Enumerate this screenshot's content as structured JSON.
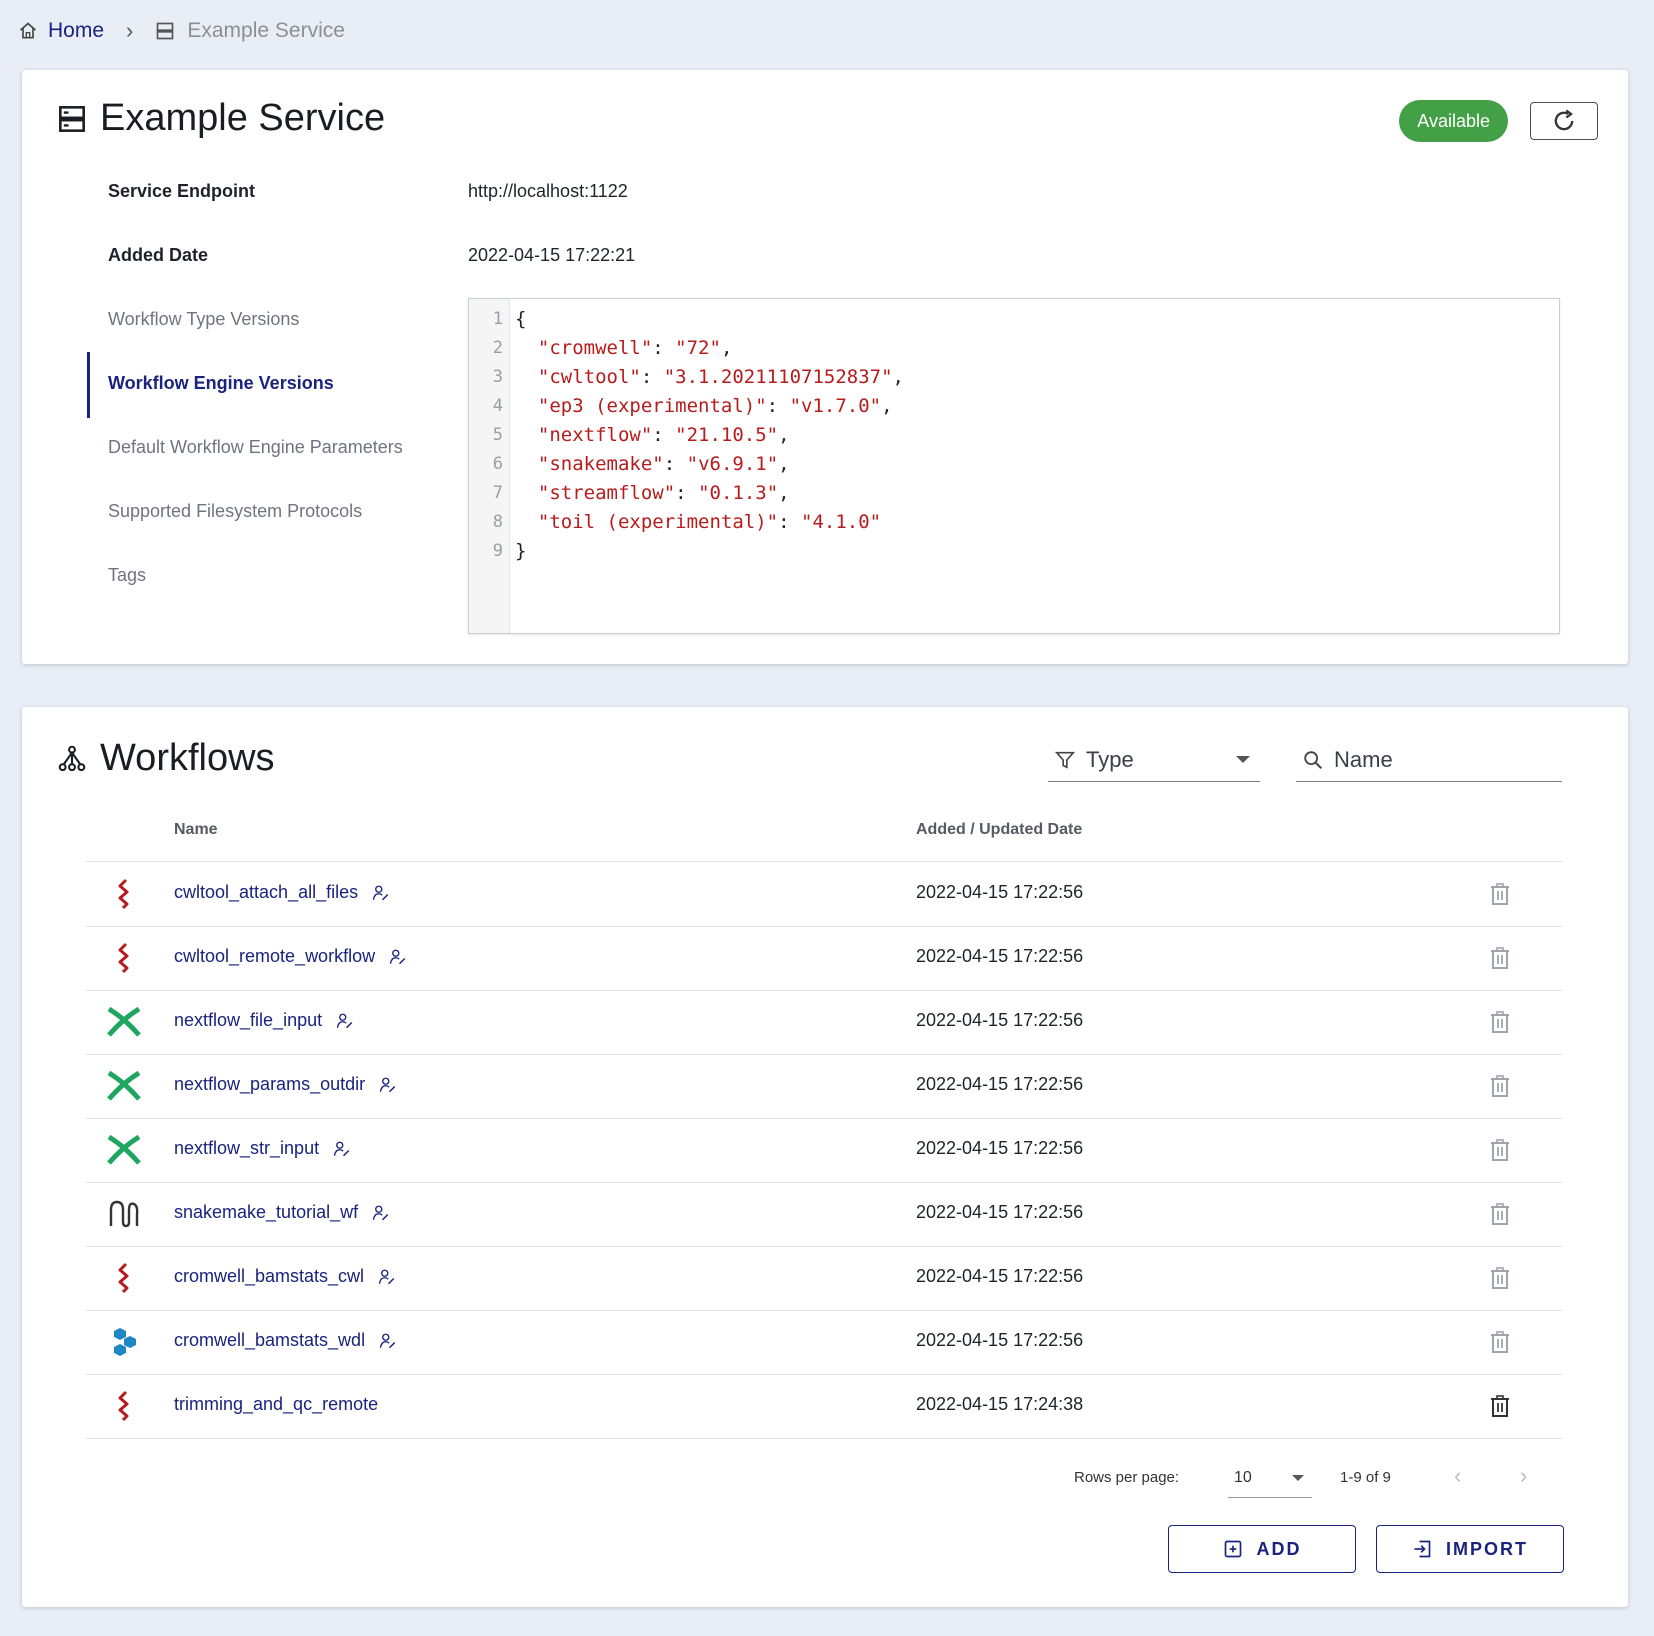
{
  "breadcrumb": {
    "home": "Home",
    "separator": "›",
    "current": "Example Service"
  },
  "service": {
    "title": "Example Service",
    "status": "Available",
    "fields": [
      {
        "label": "Service Endpoint",
        "value": "http://localhost:1122"
      },
      {
        "label": "Added Date",
        "value": "2022-04-15 17:22:21"
      }
    ],
    "tabs": [
      "Workflow Type Versions",
      "Workflow Engine Versions",
      "Default Workflow Engine Parameters",
      "Supported Filesystem Protocols",
      "Tags"
    ],
    "active_tab": "Workflow Engine Versions",
    "code_lines": [
      {
        "n": "1",
        "text": "{"
      },
      {
        "n": "2",
        "text": "  \"cromwell\": \"72\","
      },
      {
        "n": "3",
        "text": "  \"cwltool\": \"3.1.20211107152837\","
      },
      {
        "n": "4",
        "text": "  \"ep3 (experimental)\": \"v1.7.0\","
      },
      {
        "n": "5",
        "text": "  \"nextflow\": \"21.10.5\","
      },
      {
        "n": "6",
        "text": "  \"snakemake\": \"v6.9.1\","
      },
      {
        "n": "7",
        "text": "  \"streamflow\": \"0.1.3\","
      },
      {
        "n": "8",
        "text": "  \"toil (experimental)\": \"4.1.0\""
      },
      {
        "n": "9",
        "text": "}"
      }
    ]
  },
  "workflows": {
    "title": "Workflows",
    "type_filter": "Type",
    "name_search": "Name",
    "columns": {
      "name": "Name",
      "date": "Added / Updated Date"
    },
    "rows": [
      {
        "name": "cwltool_attach_all_files",
        "date": "2022-04-15 17:22:56",
        "type_icon": "cwl-icon",
        "editable": true
      },
      {
        "name": "cwltool_remote_workflow",
        "date": "2022-04-15 17:22:56",
        "type_icon": "cwl-icon",
        "editable": true
      },
      {
        "name": "nextflow_file_input",
        "date": "2022-04-15 17:22:56",
        "type_icon": "nextflow-icon",
        "editable": true
      },
      {
        "name": "nextflow_params_outdir",
        "date": "2022-04-15 17:22:56",
        "type_icon": "nextflow-icon",
        "editable": true
      },
      {
        "name": "nextflow_str_input",
        "date": "2022-04-15 17:22:56",
        "type_icon": "nextflow-icon",
        "editable": true
      },
      {
        "name": "snakemake_tutorial_wf",
        "date": "2022-04-15 17:22:56",
        "type_icon": "snakemake-icon",
        "editable": true
      },
      {
        "name": "cromwell_bamstats_cwl",
        "date": "2022-04-15 17:22:56",
        "type_icon": "cwl-icon",
        "editable": true
      },
      {
        "name": "cromwell_bamstats_wdl",
        "date": "2022-04-15 17:22:56",
        "type_icon": "wdl-icon",
        "editable": true
      },
      {
        "name": "trimming_and_qc_remote",
        "date": "2022-04-15 17:24:38",
        "type_icon": "cwl-icon",
        "editable": false
      }
    ],
    "pagination": {
      "rows_label": "Rows per page:",
      "rows_per_page": "10",
      "range": "1-9 of 9"
    },
    "add_label": "ADD",
    "import_label": "IMPORT"
  },
  "colors": {
    "accent": "#1a237e",
    "status_available": "#43a047",
    "cwl": "#b71c1c",
    "nextflow": "#1ea660",
    "wdl": "#1e88c7",
    "code_string": "#b71c1c"
  }
}
